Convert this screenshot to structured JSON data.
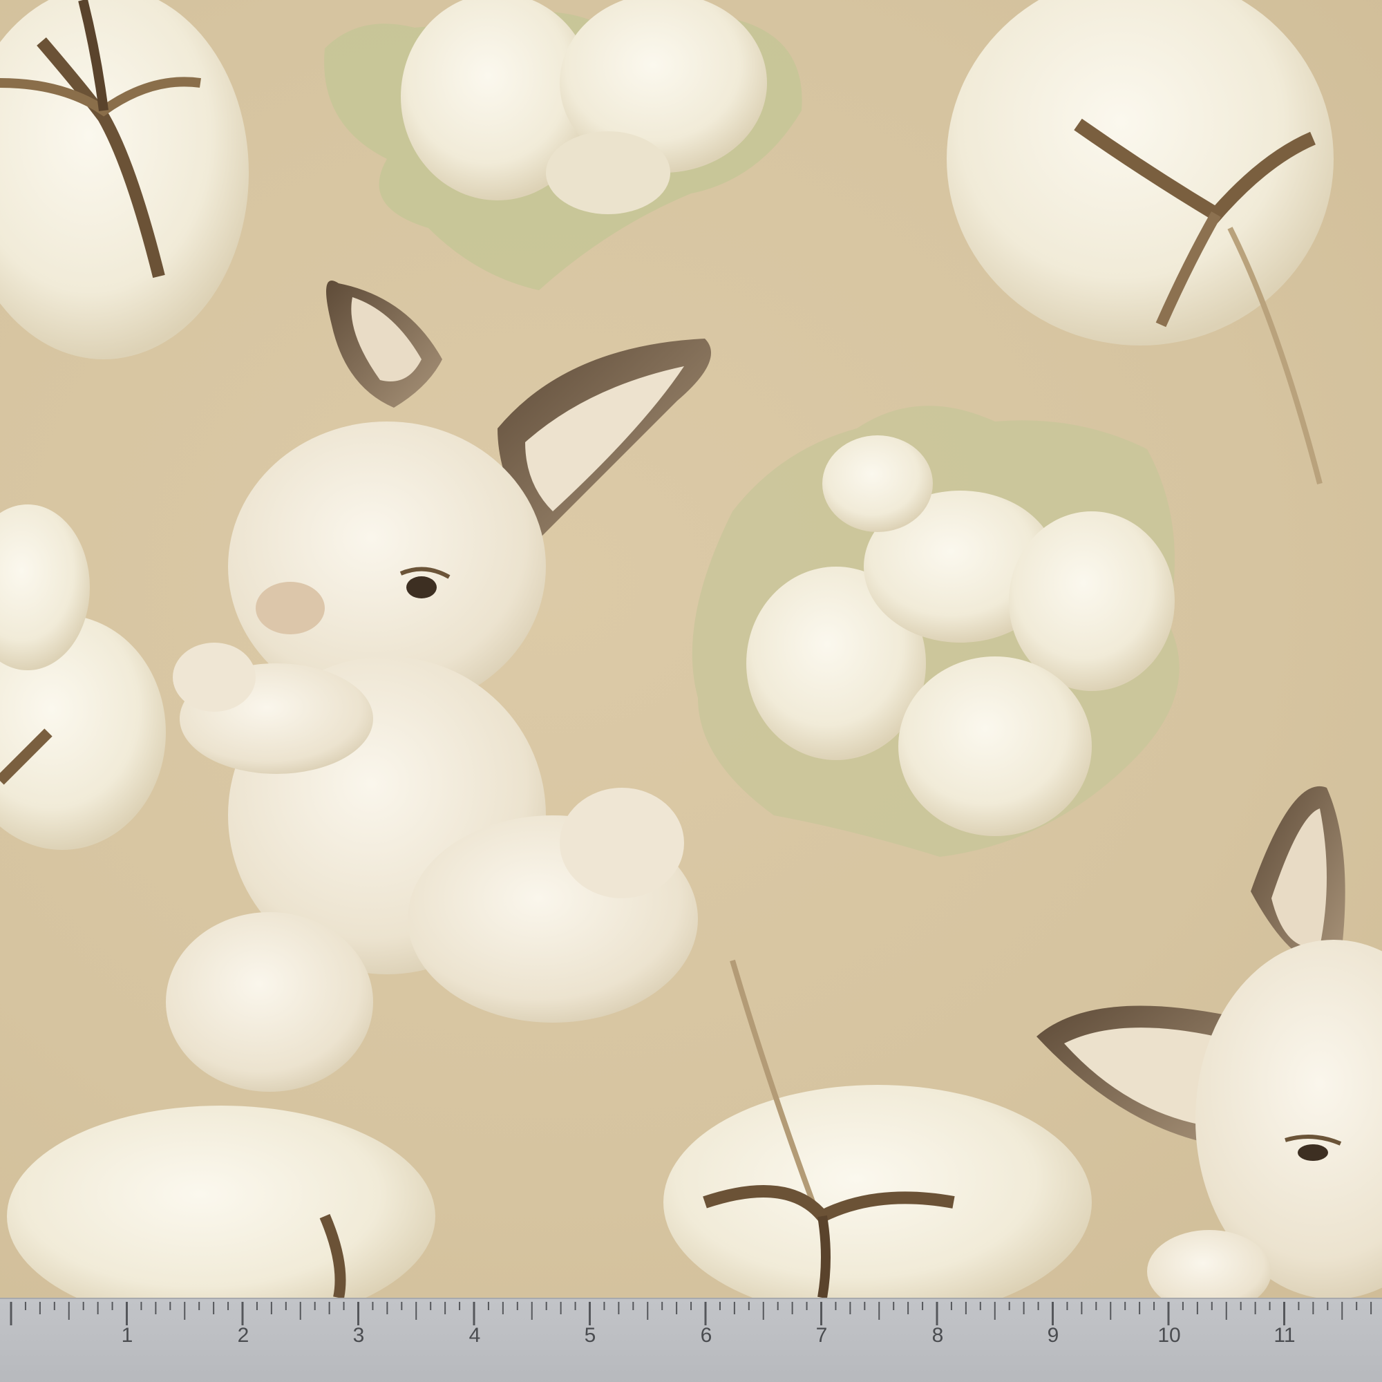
{
  "scene": {
    "background_color": "#d7c5a1",
    "cotton_color": "#f4efe0",
    "bunny_fur_color": "#efe8d8",
    "ear_inner_color": "#7a6650",
    "leaf_color": "#c9c69a"
  },
  "ruler": {
    "color": "#bcbec2",
    "unit_marks": [
      "1",
      "2",
      "3",
      "4",
      "5",
      "6",
      "7",
      "8",
      "9",
      "10",
      "11"
    ]
  }
}
